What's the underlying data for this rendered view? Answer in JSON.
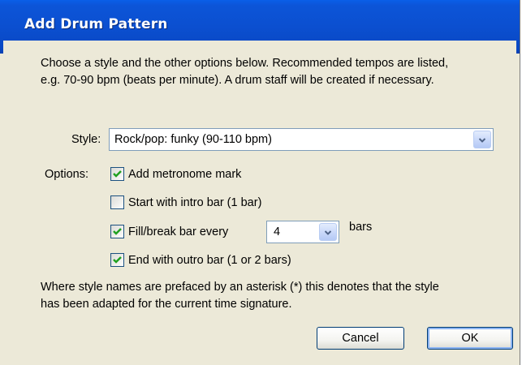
{
  "dialog": {
    "title": "Add Drum Pattern",
    "description_line1": "Choose a style and the other options below. Recommended tempos are listed,",
    "description_line2": "e.g. 70-90 bpm (beats per minute). A drum staff will be created if necessary.",
    "style_label": "Style:",
    "style_value": "Rock/pop: funky (90-110 bpm)",
    "options_label": "Options:",
    "options": {
      "metronome": {
        "label": "Add metronome mark",
        "checked": true
      },
      "intro": {
        "label": "Start with intro bar (1 bar)",
        "checked": false
      },
      "fill": {
        "label": "Fill/break bar every",
        "checked": true
      },
      "outro": {
        "label": "End with outro bar (1 or 2 bars)",
        "checked": true
      }
    },
    "fill_every_value": "4",
    "bars_label": "bars",
    "note_line1": "Where style names are prefaced by an asterisk (*) this denotes that the style",
    "note_line2": "has been adapted for the current time signature.",
    "cancel_label": "Cancel",
    "ok_label": "OK"
  },
  "colors": {
    "titlebar": "#0b4fd0",
    "dialog_bg": "#ece9d8",
    "checkmark": "#21a121"
  }
}
